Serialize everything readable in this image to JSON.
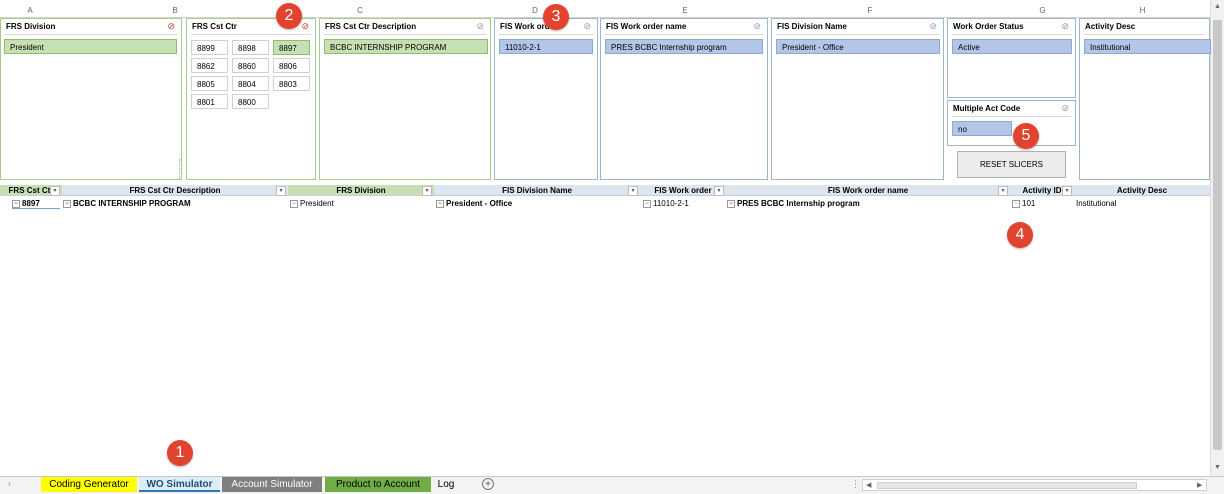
{
  "columns": [
    "A",
    "B",
    "C",
    "D",
    "E",
    "F",
    "G",
    "H"
  ],
  "slicers": {
    "frs_division": {
      "title": "FRS Division",
      "items": [
        "President"
      ]
    },
    "frs_cst_ctr": {
      "title": "FRS Cst Ctr",
      "items": [
        "8899",
        "8898",
        "8897",
        "8862",
        "8860",
        "8806",
        "8805",
        "8804",
        "8803",
        "8801",
        "8800"
      ],
      "selected": "8897"
    },
    "frs_cst_ctr_desc": {
      "title": "FRS Cst Ctr Description",
      "items": [
        "BCBC INTERNSHIP PROGRAM"
      ]
    },
    "fis_work_order": {
      "title": "FIS Work order",
      "items": [
        "11010-2-1"
      ]
    },
    "fis_work_order_name": {
      "title": "FIS Work order name",
      "items": [
        "PRES BCBC Internship program"
      ]
    },
    "fis_division_name": {
      "title": "FIS Division Name",
      "items": [
        "President - Office"
      ]
    },
    "work_order_status": {
      "title": "Work Order Status",
      "items": [
        "Active"
      ]
    },
    "multiple_act_code": {
      "title": "Multiple Act Code",
      "items": [
        "no"
      ]
    },
    "activity_desc": {
      "title": "Activity Desc",
      "items": [
        "Institutional"
      ]
    }
  },
  "reset_button": "RESET SLICERS",
  "badges": [
    "1",
    "2",
    "3",
    "4",
    "5"
  ],
  "pivot": {
    "headers": [
      "FRS Cst Ctr",
      "FRS Cst Ctr Description",
      "FRS Division",
      "FIS Division Name",
      "FIS Work order",
      "FIS Work order name",
      "Activity ID",
      "Activity Desc"
    ],
    "row": [
      "8897",
      "BCBC INTERNSHIP PROGRAM",
      "President",
      "President - Office",
      "11010-2-1",
      "PRES BCBC Internship program",
      "101",
      "Institutional"
    ]
  },
  "sheet_tabs": [
    {
      "label": "Coding Generator",
      "color": "#ffff00"
    },
    {
      "label": "WO Simulator",
      "color": "#a9d4e8"
    },
    {
      "label": "Account Simulator",
      "color": "#7f7f7f"
    },
    {
      "label": "Product to Account",
      "color": "#70ad47"
    },
    {
      "label": "Log",
      "color": "#f3f3f3"
    }
  ],
  "icons": {
    "filter": "filter-icon",
    "add": "plus-circle-icon",
    "nav": "chevron-icon"
  }
}
